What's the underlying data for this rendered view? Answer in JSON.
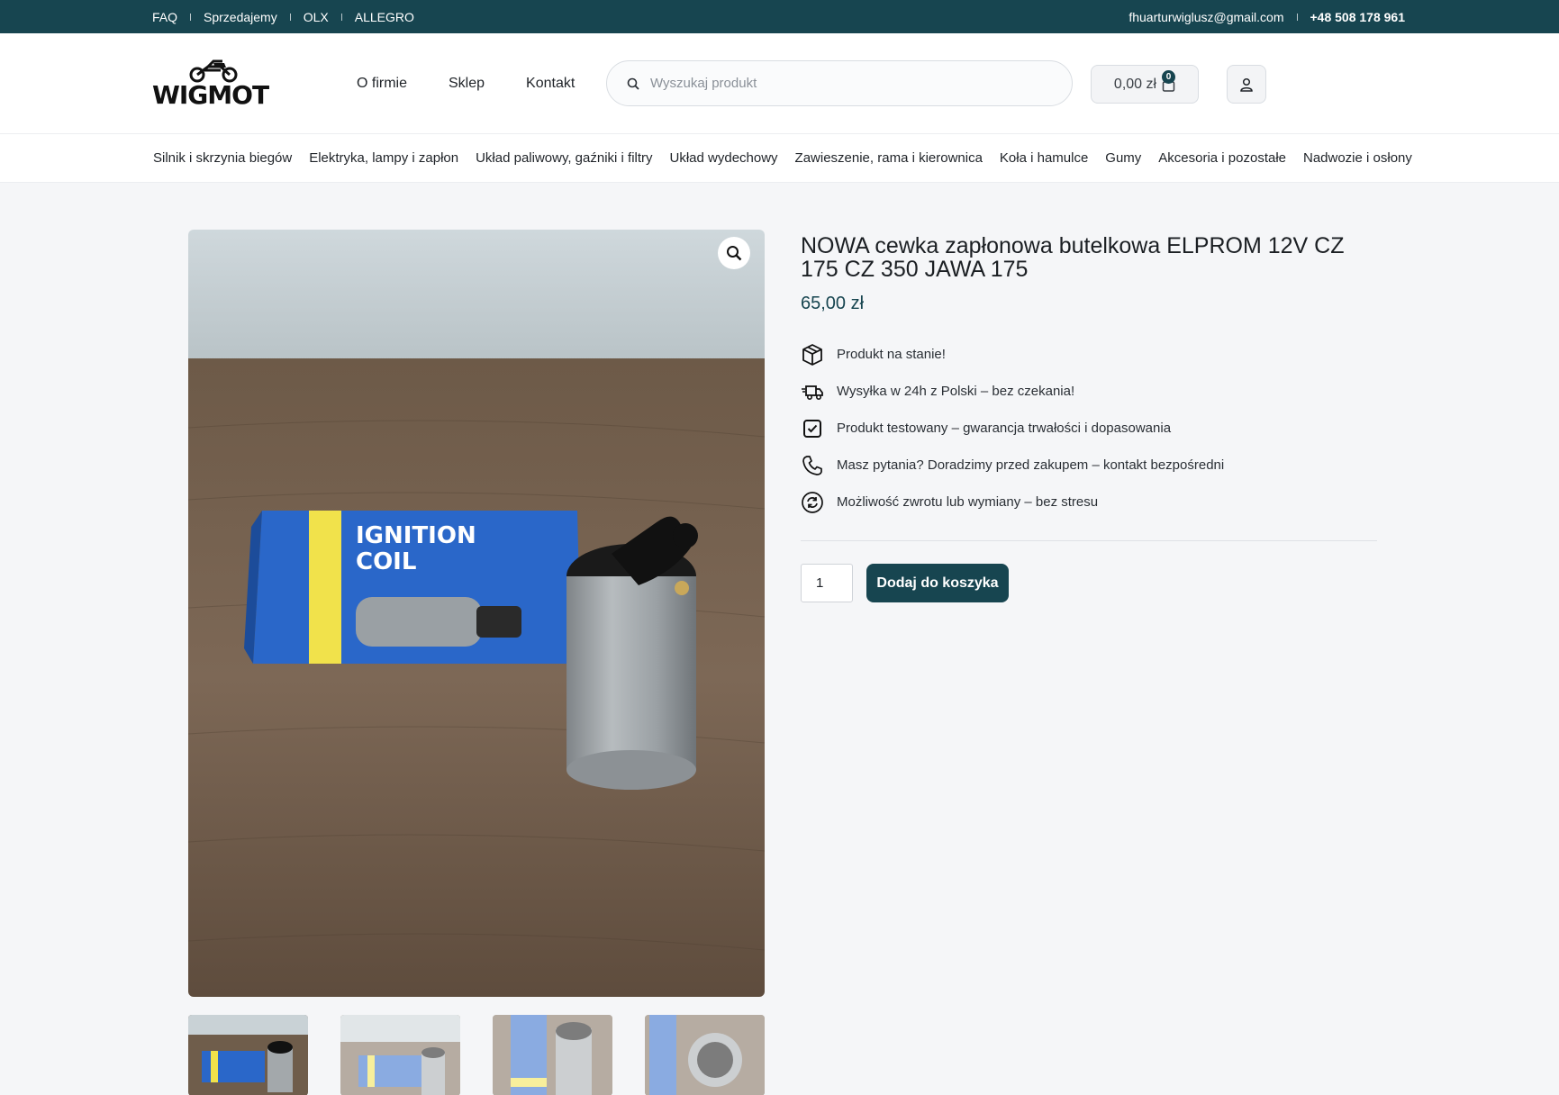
{
  "topbar": {
    "links": [
      "FAQ",
      "Sprzedajemy",
      "OLX",
      "ALLEGRO"
    ],
    "email": "fhuarturwiglusz@gmail.com",
    "phone": "+48 508 178 961"
  },
  "header": {
    "logo_text": "WIGMOT",
    "nav": [
      "O firmie",
      "Sklep",
      "Kontakt"
    ],
    "search_placeholder": "Wyszukaj produkt",
    "cart_total": "0,00 zł",
    "cart_count": "0"
  },
  "categories": [
    "Silnik i skrzynia biegów",
    "Elektryka, lampy i zapłon",
    "Układ paliwowy, gaźniki i filtry",
    "Układ wydechowy",
    "Zawieszenie, rama i kierownica",
    "Koła i hamulce",
    "Gumy",
    "Akcesoria i pozostałe",
    "Nadwozie i osłony"
  ],
  "product": {
    "title": "NOWA cewka zapłonowa butelkowa ELPROM 12V CZ 175 CZ 350 JAWA 175",
    "price": "65,00 zł",
    "image_box_text_1": "IGNITION",
    "image_box_text_2": "COIL",
    "features": [
      {
        "icon": "box-icon",
        "text": "Produkt na stanie!"
      },
      {
        "icon": "truck-icon",
        "text": "Wysyłka w 24h z Polski – bez czekania!"
      },
      {
        "icon": "checkbox-icon",
        "text": "Produkt testowany – gwarancja trwałości i dopasowania"
      },
      {
        "icon": "phone-icon",
        "text": "Masz pytania? Doradzimy przed zakupem – kontakt bezpośredni"
      },
      {
        "icon": "refresh-icon",
        "text": "Możliwość zwrotu lub wymiany – bez stresu"
      }
    ],
    "quantity": "1",
    "add_to_cart_label": "Dodaj do koszyka"
  },
  "colors": {
    "brand": "#174550",
    "page_bg": "#f5f6f8"
  }
}
